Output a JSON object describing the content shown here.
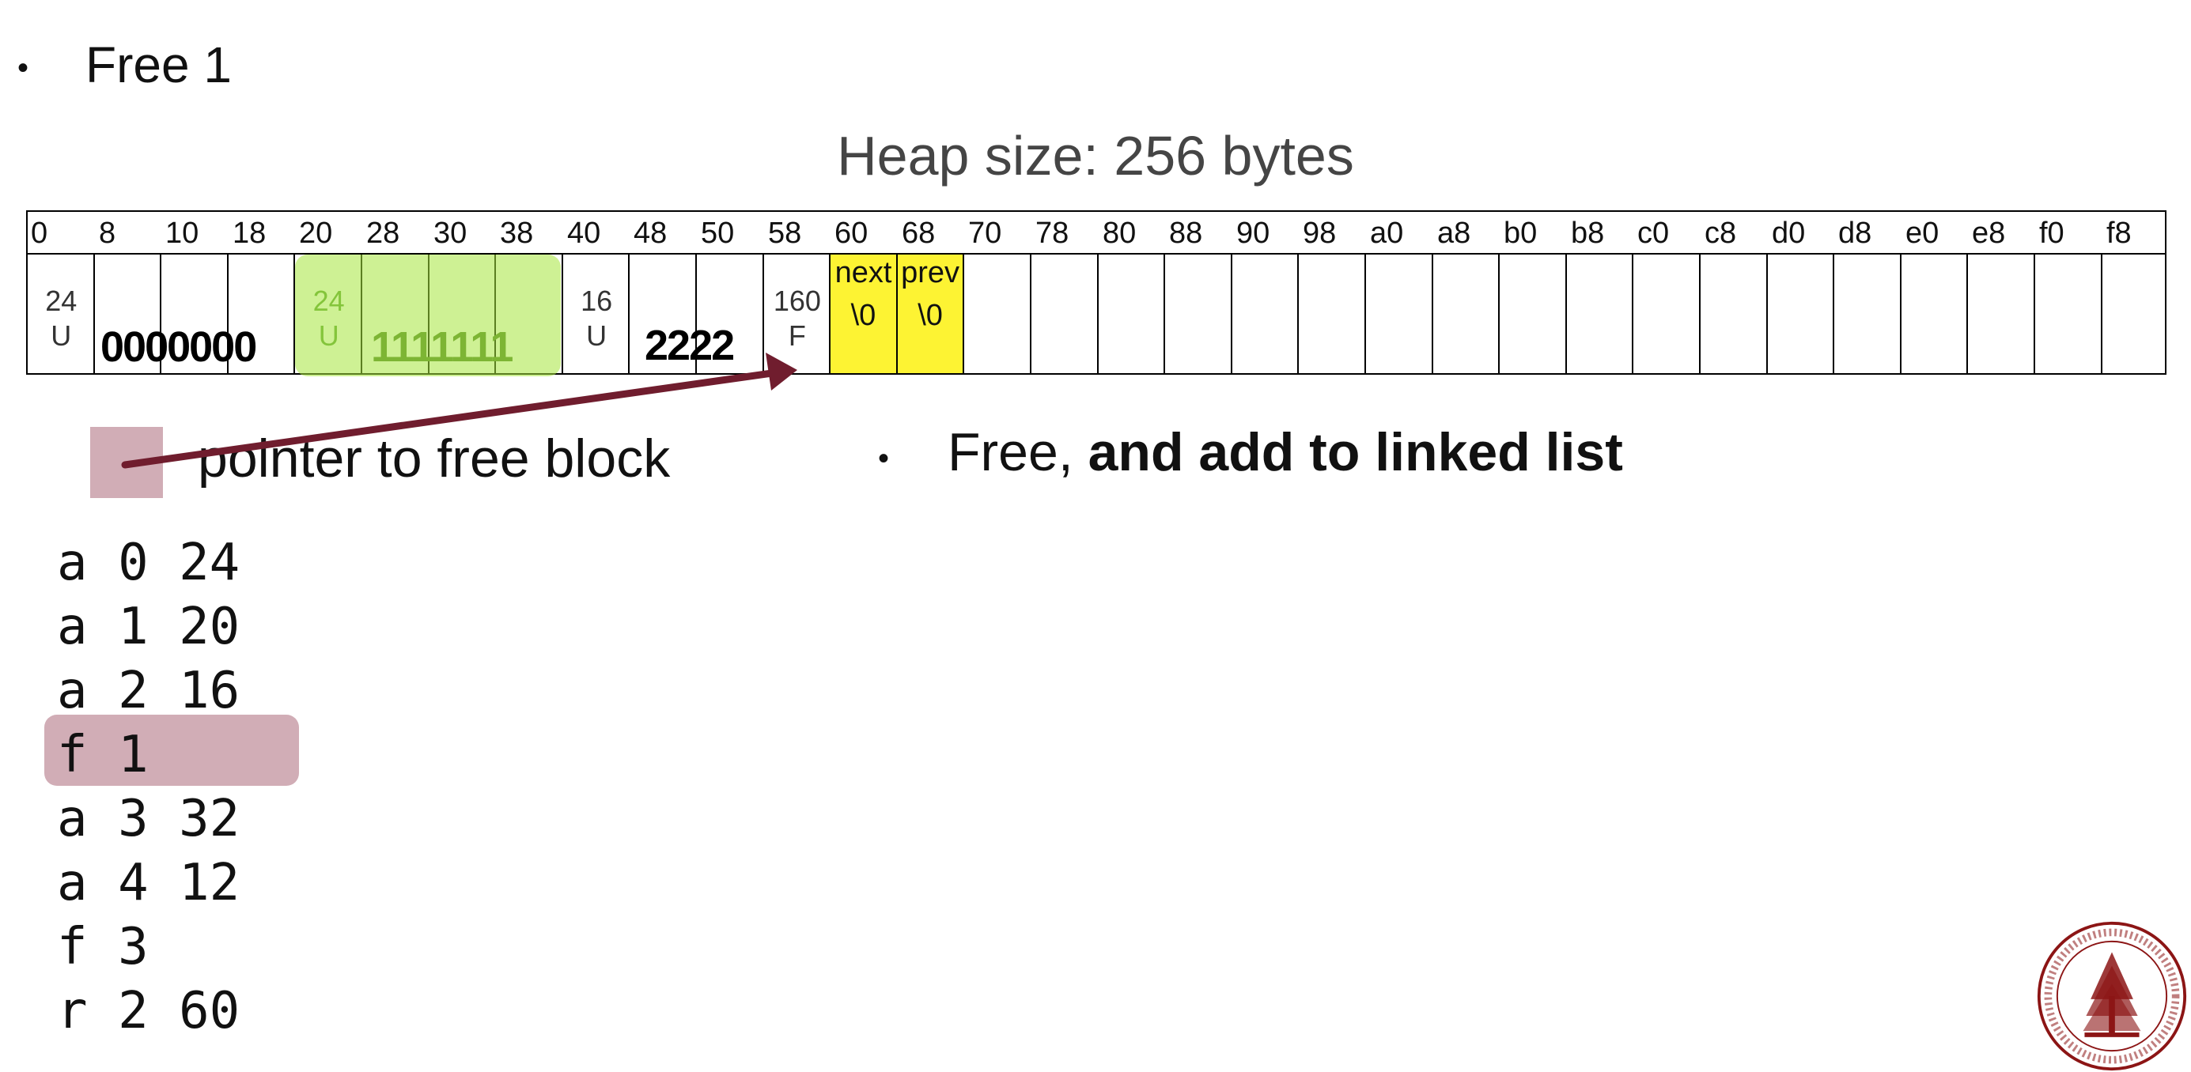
{
  "slide": {
    "bullet_symbol": "•",
    "title": "Free 1",
    "heap_title": "Heap size: 256 bytes",
    "legend_label": "pointer to free block",
    "right_note_plain": "Free, ",
    "right_note_bold": "and add to linked list"
  },
  "heap": {
    "addresses": [
      "0",
      "8",
      "10",
      "18",
      "20",
      "28",
      "30",
      "38",
      "40",
      "48",
      "50",
      "58",
      "60",
      "68",
      "70",
      "78",
      "80",
      "88",
      "90",
      "98",
      "a0",
      "a8",
      "b0",
      "b8",
      "c0",
      "c8",
      "d0",
      "d8",
      "e0",
      "e8",
      "f0",
      "f8"
    ],
    "block0": {
      "size": "24",
      "status": "U",
      "data": "0000000"
    },
    "block1": {
      "size": "24",
      "status": "U",
      "data": "1111111"
    },
    "block2": {
      "size": "16",
      "status": "U",
      "data": "2222"
    },
    "block3": {
      "size": "160",
      "status": "F",
      "next_label": "next",
      "next_value": "\\0",
      "prev_label": "prev",
      "prev_value": "\\0"
    }
  },
  "commands": [
    "a 0 24",
    "a 1 20",
    "a 2 16",
    "f 1",
    "a 3 32",
    "a 4 12",
    "f 3",
    "r 2 60"
  ],
  "highlighted_command_index": 3,
  "colors": {
    "highlight_pink": "#d1adb6",
    "arrow": "#701d2e",
    "green_block": "#a6e63c",
    "yellow_free": "#fdf333"
  },
  "icons": {
    "logo": "stanford-seal-icon"
  }
}
